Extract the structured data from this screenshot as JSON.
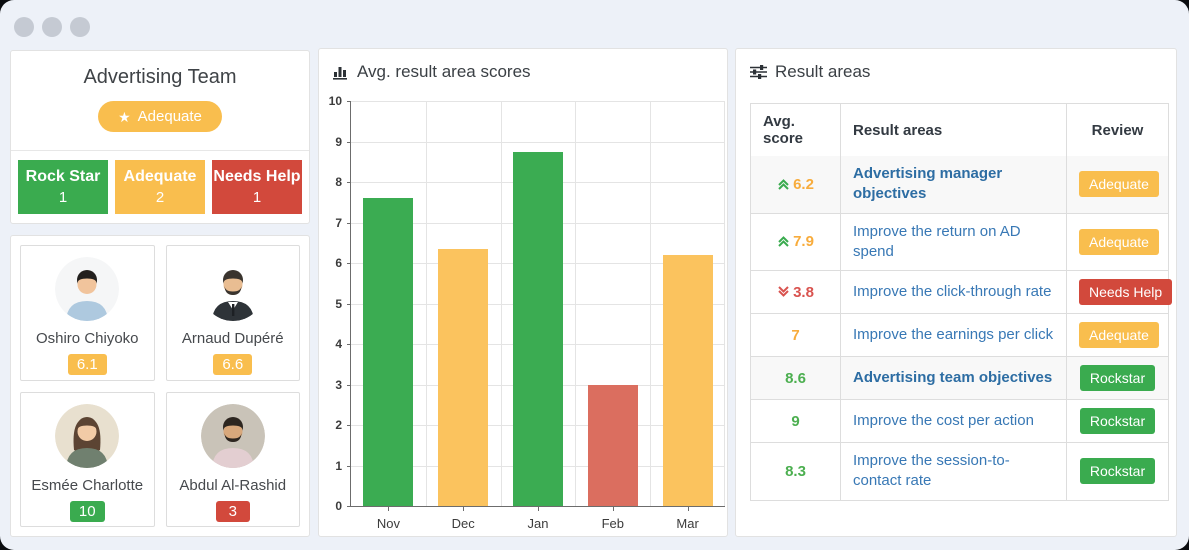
{
  "team_panel": {
    "title": "Advertising Team",
    "status_badge": {
      "label": "Adequate",
      "icon": "star",
      "color": "#f9be4e"
    },
    "stats": [
      {
        "label": "Rock Star",
        "count": "1",
        "color": "green"
      },
      {
        "label": "Adequate",
        "count": "2",
        "color": "orange"
      },
      {
        "label": "Needs Help",
        "count": "1",
        "color": "red"
      }
    ]
  },
  "members": [
    {
      "name": "Oshiro Chiyoko",
      "score": "6.1",
      "score_color": "orange",
      "avatar": {
        "bg": "#f5f6f7",
        "hair": "#23201e",
        "skin": "#f1c49c",
        "shirt": "#aec9df",
        "beard": false,
        "long_hair": false,
        "suit": false
      }
    },
    {
      "name": "Arnaud Dupéré",
      "score": "6.6",
      "score_color": "orange",
      "avatar": {
        "bg": "#ffffff",
        "hair": "#3a342e",
        "skin": "#e9bd92",
        "shirt": "#2e3338",
        "beard": true,
        "long_hair": false,
        "suit": true
      }
    },
    {
      "name": "Esmée Charlotte",
      "score": "10",
      "score_color": "green",
      "avatar": {
        "bg": "#e8e0cf",
        "hair": "#5c4433",
        "skin": "#f2cba6",
        "shirt": "#70806f",
        "beard": false,
        "long_hair": true,
        "suit": false
      }
    },
    {
      "name": "Abdul Al-Rashid",
      "score": "3",
      "score_color": "red",
      "avatar": {
        "bg": "#c9c3b8",
        "hair": "#2d2620",
        "skin": "#d8a87c",
        "shirt": "#e3ced1",
        "beard": true,
        "long_hair": false,
        "suit": false
      }
    }
  ],
  "chart_panel": {
    "title": "Avg. result area scores"
  },
  "chart_data": {
    "type": "bar",
    "title": "Avg. result area scores",
    "categories": [
      "Nov",
      "Dec",
      "Jan",
      "Feb",
      "Mar"
    ],
    "values": [
      7.6,
      6.35,
      8.75,
      3,
      6.2
    ],
    "bar_colors": [
      "#3bac52",
      "#fbc35e",
      "#3bac52",
      "#db6e5f",
      "#fbc35e"
    ],
    "xlabel": "",
    "ylabel": "",
    "ylim": [
      0,
      10
    ],
    "yticks": [
      0,
      1,
      2,
      3,
      4,
      5,
      6,
      7,
      8,
      9,
      10
    ],
    "grid": true,
    "legend": false
  },
  "result_areas_panel": {
    "title": "Result areas",
    "table": {
      "headers": [
        "Avg. score",
        "Result areas",
        "Review"
      ],
      "rows": [
        {
          "score": "6.2",
          "trend": "up",
          "score_color": "orange",
          "area": "Advertising manager objectives",
          "bold": true,
          "review": "Adequate",
          "review_color": "orange",
          "shaded": true
        },
        {
          "score": "7.9",
          "trend": "up",
          "score_color": "orange",
          "area": "Improve the return on AD spend",
          "bold": false,
          "review": "Adequate",
          "review_color": "orange",
          "shaded": false
        },
        {
          "score": "3.8",
          "trend": "down",
          "score_color": "red",
          "area": "Improve the click-through rate",
          "bold": false,
          "review": "Needs Help",
          "review_color": "red",
          "shaded": false
        },
        {
          "score": "7",
          "trend": "none",
          "score_color": "orange",
          "area": "Improve the earnings per click",
          "bold": false,
          "review": "Adequate",
          "review_color": "orange",
          "shaded": false
        },
        {
          "score": "8.6",
          "trend": "none",
          "score_color": "green",
          "area": "Advertising team objectives",
          "bold": true,
          "review": "Rockstar",
          "review_color": "green",
          "shaded": true
        },
        {
          "score": "9",
          "trend": "none",
          "score_color": "green",
          "area": "Improve the cost per action",
          "bold": false,
          "review": "Rockstar",
          "review_color": "green",
          "shaded": false
        },
        {
          "score": "8.3",
          "trend": "none",
          "score_color": "green",
          "area": "Improve the session-to-contact rate",
          "bold": false,
          "review": "Rockstar",
          "review_color": "green",
          "shaded": false
        }
      ]
    }
  },
  "colors": {
    "green": "#3aab4f",
    "orange": "#f9be4e",
    "red": "#d2493c",
    "bar_red": "#db6e5f",
    "link_blue": "#3878b5",
    "background": "#edf1f8"
  }
}
